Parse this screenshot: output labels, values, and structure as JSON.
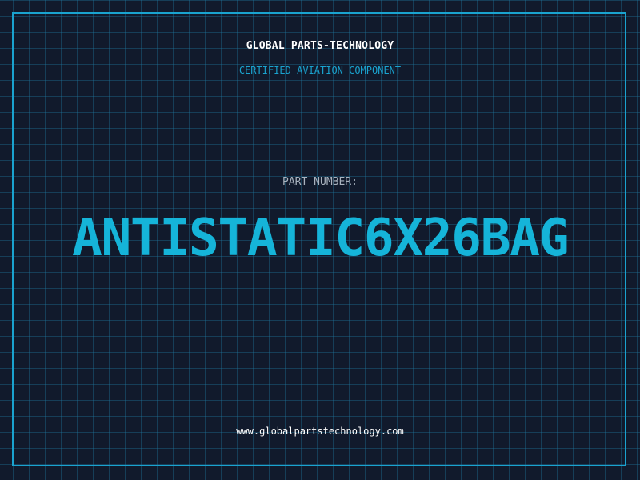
{
  "header": {
    "company": "GLOBAL PARTS-TECHNOLOGY",
    "subtitle": "CERTIFIED AVIATION COMPONENT"
  },
  "part": {
    "label": "PART NUMBER:",
    "number": "ANTISTATIC6X26BAG"
  },
  "footer": {
    "website": "www.globalpartstechnology.com"
  },
  "colors": {
    "background": "#111a2c",
    "accent": "#1aa3cf",
    "part_number": "#15b4d9",
    "label": "#a9b3bf",
    "text": "#ffffff"
  }
}
